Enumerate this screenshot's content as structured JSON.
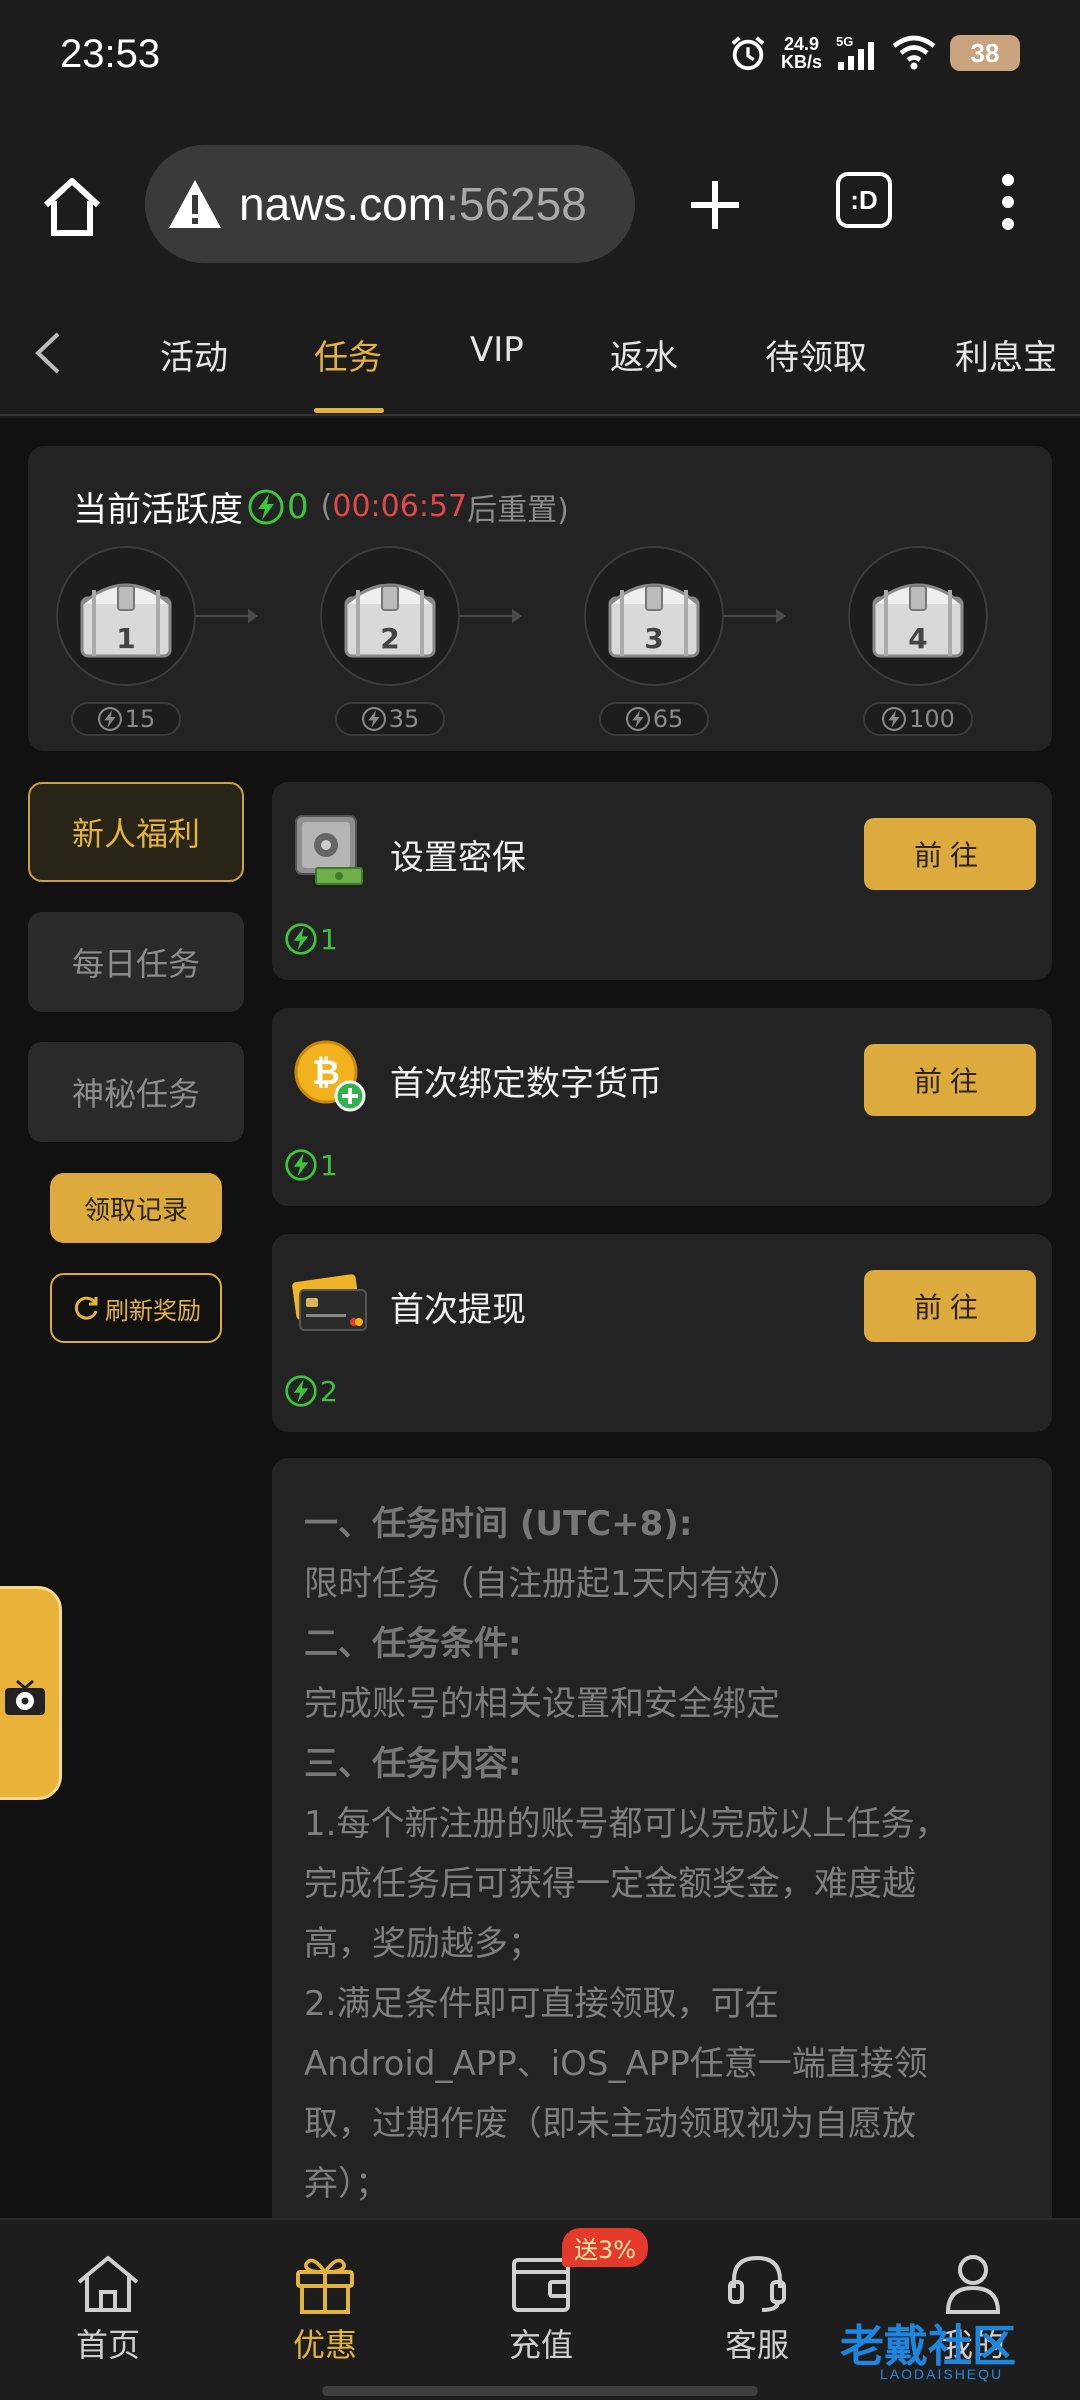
{
  "status_bar": {
    "time": "23:53",
    "net_speed_value": "24.9",
    "net_speed_unit": "KB/s",
    "network": "5G",
    "battery": "38",
    "icons": [
      "alarm-icon",
      "signal-icon",
      "wifi-icon",
      "battery-icon"
    ]
  },
  "browser": {
    "url_host": "naws.com",
    "url_port": ":56258",
    "tabs_label": ":D",
    "icons": [
      "home-icon",
      "warning-icon",
      "plus-icon",
      "more-vert-icon"
    ]
  },
  "nav": {
    "tabs": [
      "活动",
      "任务",
      "VIP",
      "返水",
      "待领取",
      "利息宝"
    ],
    "active_index": 1
  },
  "activity": {
    "title": "当前活跃度",
    "value": "0",
    "paren_open": "(",
    "countdown": "00:06:57",
    "reset_text": "后重置)",
    "chests": [
      {
        "num": "1",
        "need": "15"
      },
      {
        "num": "2",
        "need": "35"
      },
      {
        "num": "3",
        "need": "65"
      },
      {
        "num": "4",
        "need": "100"
      }
    ]
  },
  "side_menu": {
    "items": [
      "新人福利",
      "每日任务",
      "神秘任务"
    ],
    "active_index": 0,
    "record_label": "领取记录",
    "refresh_label": "刷新奖励"
  },
  "tasks": [
    {
      "title": "设置密保",
      "reward": "1",
      "button": "前往",
      "icon": "safe-icon"
    },
    {
      "title": "首次绑定数字货币",
      "reward": "1",
      "button": "前往",
      "icon": "bitcoin-icon"
    },
    {
      "title": "首次提现",
      "reward": "2",
      "button": "前往",
      "icon": "bank-card-icon"
    }
  ],
  "rules": [
    {
      "text": "一、任务时间 (UTC+8):",
      "heading": true
    },
    {
      "text": "限时任务（自注册起1天内有效）",
      "heading": false
    },
    {
      "text": "二、任务条件:",
      "heading": true
    },
    {
      "text": "完成账号的相关设置和安全绑定",
      "heading": false
    },
    {
      "text": "三、任务内容:",
      "heading": true
    },
    {
      "text": "1.每个新注册的账号都可以完成以上任务，",
      "heading": false
    },
    {
      "text": "完成任务后可获得一定金额奖金，难度越",
      "heading": false
    },
    {
      "text": "高，奖励越多；",
      "heading": false
    },
    {
      "text": "2.满足条件即可直接领取，可在",
      "heading": false
    },
    {
      "text": "Android_APP、iOS_APP任意一端直接领",
      "heading": false
    },
    {
      "text": "取，过期作废（即未主动领取视为自愿放",
      "heading": false
    },
    {
      "text": "弃）；",
      "heading": false
    }
  ],
  "bottom_nav": {
    "items": [
      {
        "label": "首页",
        "icon": "home-icon"
      },
      {
        "label": "优惠",
        "icon": "gift-icon"
      },
      {
        "label": "充值",
        "icon": "wallet-icon"
      },
      {
        "label": "客服",
        "icon": "headset-icon"
      },
      {
        "label": "我的",
        "icon": "user-icon"
      }
    ],
    "active_index": 1,
    "promo_badge": "送3%"
  },
  "watermark": {
    "text": "老戴社区",
    "sub": "LAODAISHEQU"
  },
  "colors": {
    "accent": "#e3b33f",
    "button_gold": "#dcaa3d",
    "energy_green": "#3dc43d",
    "countdown_red": "#e14848",
    "background": "#111111",
    "card": "#232323"
  }
}
